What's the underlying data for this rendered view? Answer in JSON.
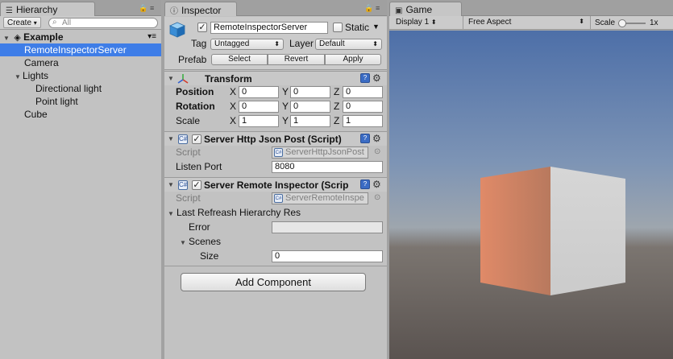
{
  "hierarchy": {
    "tab_label": "Hierarchy",
    "create_label": "Create",
    "search_placeholder": "All",
    "scene_name": "Example",
    "items": [
      {
        "label": "RemoteInspectorServer"
      },
      {
        "label": "Camera"
      },
      {
        "label": "Lights"
      },
      {
        "label": "Directional light"
      },
      {
        "label": "Point light"
      },
      {
        "label": "Cube"
      }
    ]
  },
  "inspector": {
    "tab_label": "Inspector",
    "object_name": "RemoteInspectorServer",
    "static_label": "Static",
    "tag_label": "Tag",
    "tag_value": "Untagged",
    "layer_label": "Layer",
    "layer_value": "Default",
    "prefab_label": "Prefab",
    "prefab_buttons": {
      "select": "Select",
      "revert": "Revert",
      "apply": "Apply"
    },
    "transform": {
      "title": "Transform",
      "position_label": "Position",
      "rotation_label": "Rotation",
      "scale_label": "Scale",
      "axis_x": "X",
      "axis_y": "Y",
      "axis_z": "Z",
      "position": {
        "x": "0",
        "y": "0",
        "z": "0"
      },
      "rotation": {
        "x": "0",
        "y": "0",
        "z": "0"
      },
      "scale": {
        "x": "1",
        "y": "1",
        "z": "1"
      }
    },
    "http_json_post": {
      "title": "Server Http Json Post (Script)",
      "script_label": "Script",
      "script_value": "ServerHttpJsonPost",
      "listen_port_label": "Listen Port",
      "listen_port_value": "8080"
    },
    "remote_inspector": {
      "title": "Server Remote Inspector (Scrip",
      "script_label": "Script",
      "script_value": "ServerRemoteInspe",
      "last_refresh_label": "Last Refreash Hierarchy Res",
      "error_label": "Error",
      "error_value": "",
      "scenes_label": "Scenes",
      "size_label": "Size",
      "size_value": "0"
    },
    "add_component_label": "Add Component"
  },
  "game": {
    "tab_label": "Game",
    "display_value": "Display 1",
    "aspect_value": "Free Aspect",
    "scale_label": "Scale",
    "scale_value": "1x",
    "scale_slider_fraction": 0.0
  },
  "colors": {
    "selection": "#3e7de7",
    "cube_left_face": "#e08a68",
    "cube_front_face": "#d6d6d6"
  }
}
